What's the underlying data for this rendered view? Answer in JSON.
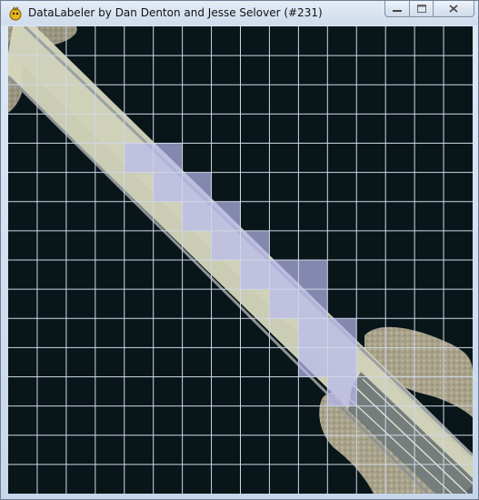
{
  "window": {
    "title": "DataLabeler by Dan Denton and Jesse Selover (#231)",
    "icon": "pygame-snake-icon",
    "controls": [
      "minimize",
      "maximize",
      "close"
    ]
  },
  "grid": {
    "columns": 16,
    "rows": 16,
    "line_color": "#cfd8e6",
    "label_color": "#b9b9f0",
    "labeled_cells": [
      [
        4,
        4
      ],
      [
        5,
        4
      ],
      [
        5,
        5
      ],
      [
        6,
        5
      ],
      [
        6,
        6
      ],
      [
        7,
        6
      ],
      [
        7,
        7
      ],
      [
        8,
        7
      ],
      [
        8,
        8
      ],
      [
        9,
        8
      ],
      [
        10,
        8
      ],
      [
        9,
        9
      ],
      [
        10,
        9
      ],
      [
        10,
        10
      ],
      [
        11,
        10
      ],
      [
        10,
        11
      ],
      [
        11,
        11
      ],
      [
        11,
        12
      ]
    ]
  },
  "colors": {
    "water": "#081519",
    "road": "#d6d6bd",
    "sand": "#b9b19a"
  }
}
